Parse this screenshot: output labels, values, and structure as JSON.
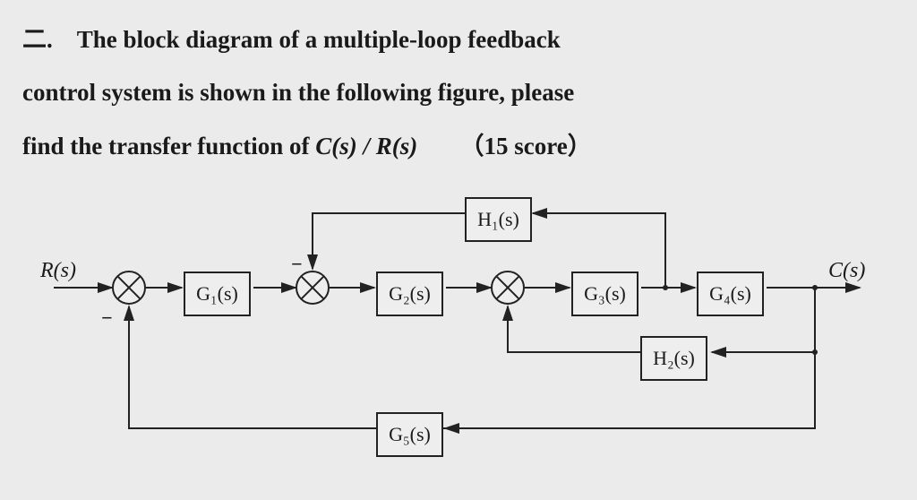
{
  "problem": {
    "number": "二.",
    "text1": "The block diagram of a multiple-loop feedback",
    "text2": "control system is shown in the following figure, please",
    "text3": "find the transfer function of ",
    "tf": "C(s) / R(s)",
    "score": "（15 score）"
  },
  "diagram": {
    "input": "R(s)",
    "output": "C(s)",
    "blocks": {
      "G1": "G₁(s)",
      "G2": "G₂(s)",
      "G3": "G₃(s)",
      "G4": "G₄(s)",
      "G5": "G₅(s)",
      "H1": "H₁(s)",
      "H2": "H₂(s)"
    },
    "signs": {
      "minus1": "−",
      "minus2": "−"
    }
  },
  "topology_notes": "Forward path R→G1→G2→G3→G4→C. Inner positive feedback loop: C through H2 to summing junction between G2 and G3. Feedback loop: pickoff between G3 and G4, through H1, back (negative) to summing junction between G1 and G2. Outer feedback: C through G5 back (negative) to first summing junction."
}
